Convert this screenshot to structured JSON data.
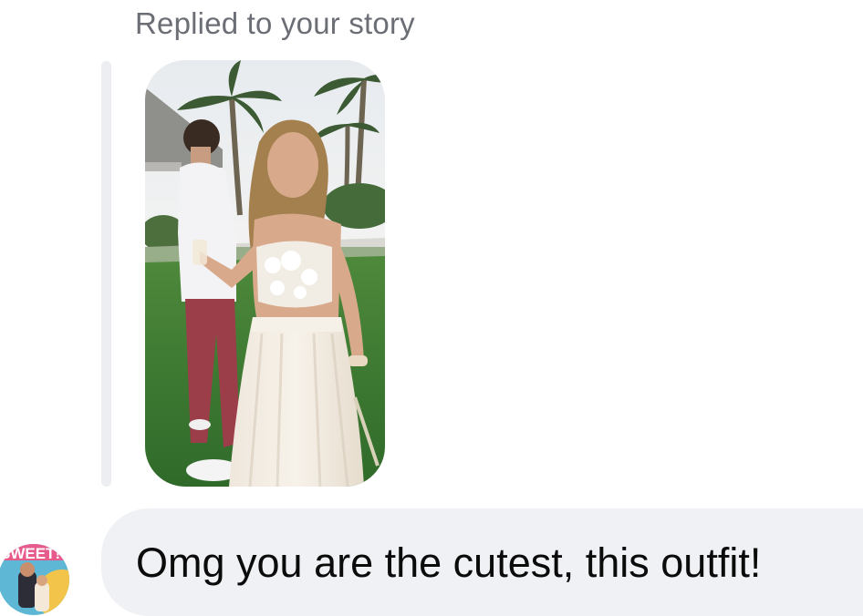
{
  "thread": {
    "reply_label": "Replied to your story",
    "story_preview": {
      "icon": "story-photo",
      "alt": "Story photo"
    },
    "message": {
      "text": "Omg you are the cutest, this outfit!"
    },
    "sender_avatar": {
      "icon": "profile-avatar",
      "badge_text": "SWEET!"
    }
  },
  "colors": {
    "bubble_bg": "#f0f1f4",
    "reply_bar": "#eceef1",
    "label_text": "#6b6f75",
    "message_text": "#0b0b0c"
  }
}
